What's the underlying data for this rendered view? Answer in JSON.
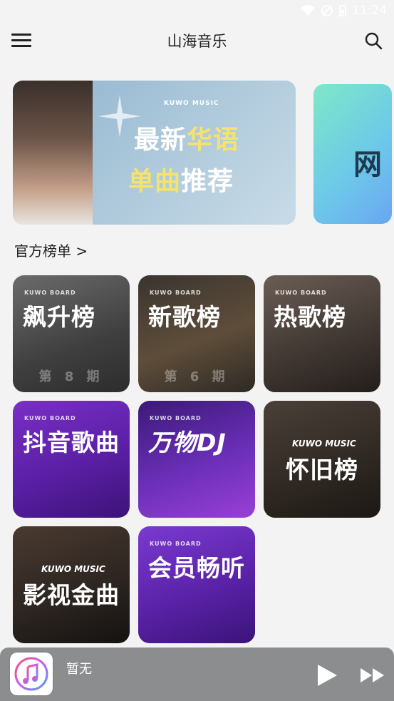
{
  "status_bar": {
    "time": "11:24"
  },
  "header": {
    "title": "山海音乐"
  },
  "banners": [
    {
      "brand": "KUWO MUSIC",
      "line1_a": "最新",
      "line1_b": "华语",
      "line2_a": "单曲",
      "line2_b": "推荐"
    },
    {
      "partial_text": "网"
    }
  ],
  "section": {
    "title": "官方榜单 >"
  },
  "cards": [
    {
      "brand": "KUWO BOARD",
      "label": "飙升榜",
      "sub": "第 8 期",
      "gradient": "linear-gradient(160deg,#6b6b6b 0%,#3f3f3f 60%,#2c2c2c 100%)"
    },
    {
      "brand": "KUWO BOARD",
      "label": "新歌榜",
      "sub": "第 6 期",
      "gradient": "linear-gradient(160deg,#3a3530 0%,#5e4d3a 55%,#2e2a26 100%)"
    },
    {
      "brand": "KUWO BOARD",
      "label": "热歌榜",
      "sub": "",
      "gradient": "linear-gradient(160deg,#6a5d55 0%,#3f3631 60%,#231e1b 100%)"
    },
    {
      "brand": "KUWO BOARD",
      "label": "抖音歌曲",
      "sub": "",
      "gradient": "linear-gradient(160deg,#7a2fc6 0%,#5a1fa5 55%,#3d1378 100%)"
    },
    {
      "brand": "KUWO BOARD",
      "label": "万物DJ",
      "sub": "",
      "gradient": "linear-gradient(160deg,#3b1a78 0%,#6b2fb8 55%,#9a3fd6 100%)"
    },
    {
      "brand": "KUWO MUSIC",
      "label": "怀旧榜",
      "sub": "",
      "gradient": "linear-gradient(160deg,#4a4038 0%,#2f2822 60%,#1c1814 100%)"
    },
    {
      "brand": "KUWO MUSIC",
      "label": "影视金曲",
      "sub": "",
      "gradient": "linear-gradient(160deg,#4a3a30 0%,#2b2420 60%,#141210 100%)"
    },
    {
      "brand": "KUWO BOARD",
      "label": "会员畅听",
      "sub": "",
      "gradient": "linear-gradient(160deg,#7a3ad0 0%,#5a22a8 55%,#3a1478 100%)"
    }
  ],
  "player": {
    "title": "暂无"
  },
  "colors": {
    "background": "#f3f3f3",
    "player_bar": "#8c8d8f",
    "highlight_yellow": "#f7e36b"
  },
  "icons": [
    "menu-icon",
    "search-icon",
    "wifi-icon",
    "signal-icon",
    "battery-icon",
    "music-app-icon",
    "play-icon",
    "next-icon"
  ]
}
